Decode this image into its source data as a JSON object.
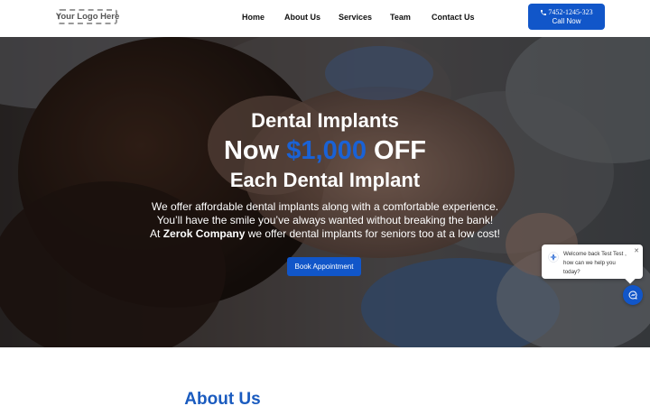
{
  "header": {
    "logo_text": "Your Logo Here",
    "nav": [
      {
        "label": "Home"
      },
      {
        "label": "About Us"
      },
      {
        "label": "Services"
      },
      {
        "label": "Team"
      },
      {
        "label": "Contact Us"
      }
    ],
    "call_button": {
      "phone": "7452-1245-323",
      "label": "Call Now",
      "icon": "phone-icon"
    }
  },
  "hero": {
    "line1": "Dental Implants",
    "line2_prefix": "Now ",
    "line2_price": "$1,000",
    "line2_suffix": " OFF",
    "line3": "Each Dental Implant",
    "desc_line1": "We offer affordable dental implants along with a comfortable experience.",
    "desc_line2": "You’ll have the smile you’ve always wanted without breaking the bank!",
    "desc_line3_prefix": "At ",
    "desc_line3_company": "Zerok Company",
    "desc_line3_suffix": " we offer dental implants for seniors too at a low cost!",
    "button_label": "Book Appointment"
  },
  "chat": {
    "message_line1": "Welcome back Test Test ,",
    "message_line2": "how can we help you",
    "message_line3": "today?",
    "close_icon": "close-icon",
    "launcher_icon": "chat-icon"
  },
  "about": {
    "title": "About Us"
  },
  "colors": {
    "accent": "#1156c9",
    "price": "#1a62d6",
    "about_title": "#1a5bbf",
    "nav_text": "#111111"
  }
}
